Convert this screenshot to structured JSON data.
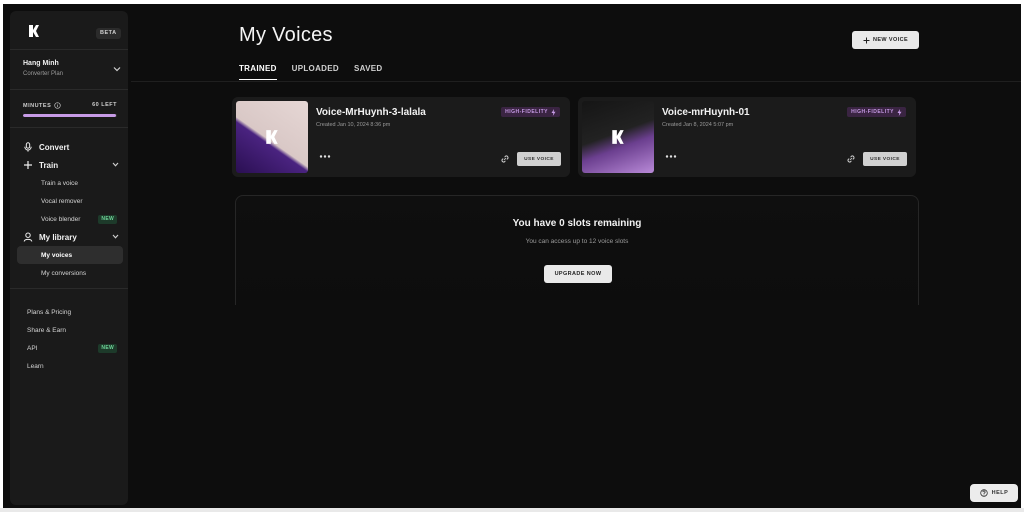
{
  "app": {
    "beta_label": "BETA"
  },
  "user": {
    "name": "Hang Minh",
    "plan": "Converter Plan"
  },
  "minutes": {
    "label": "MINUTES",
    "left": "60 LEFT",
    "fraction_remaining": 0.99
  },
  "nav": {
    "convert": "Convert",
    "train": "Train",
    "train_items": [
      "Train a voice",
      "Vocal remover",
      "Voice blender"
    ],
    "new_badge": "NEW",
    "library": "My library",
    "library_items": [
      "My voices",
      "My conversions"
    ],
    "bottom": [
      "Plans & Pricing",
      "Share & Earn",
      "API",
      "Learn"
    ]
  },
  "page": {
    "title": "My Voices",
    "new_voice": "NEW VOICE"
  },
  "tabs": [
    "TRAINED",
    "UPLOADED",
    "SAVED"
  ],
  "voices": [
    {
      "name": "Voice-MrHuynh-3-lalala",
      "created": "Created Jan 10, 2024 8:36 pm",
      "badge": "HIGH-FIDELITY",
      "action": "USE VOICE"
    },
    {
      "name": "Voice-mrHuynh-01",
      "created": "Created Jan 8, 2024 5:07 pm",
      "badge": "HIGH-FIDELITY",
      "action": "USE VOICE"
    }
  ],
  "slots": {
    "title": "You have 0 slots remaining",
    "subtitle": "You can access up to 12 voice slots",
    "cta": "UPGRADE NOW"
  },
  "help": "HELP",
  "colors": {
    "accent": "#c79be6",
    "background": "#0d0d0d",
    "sidebar": "#1a1a1a",
    "new_badge": "#6fd69a"
  }
}
